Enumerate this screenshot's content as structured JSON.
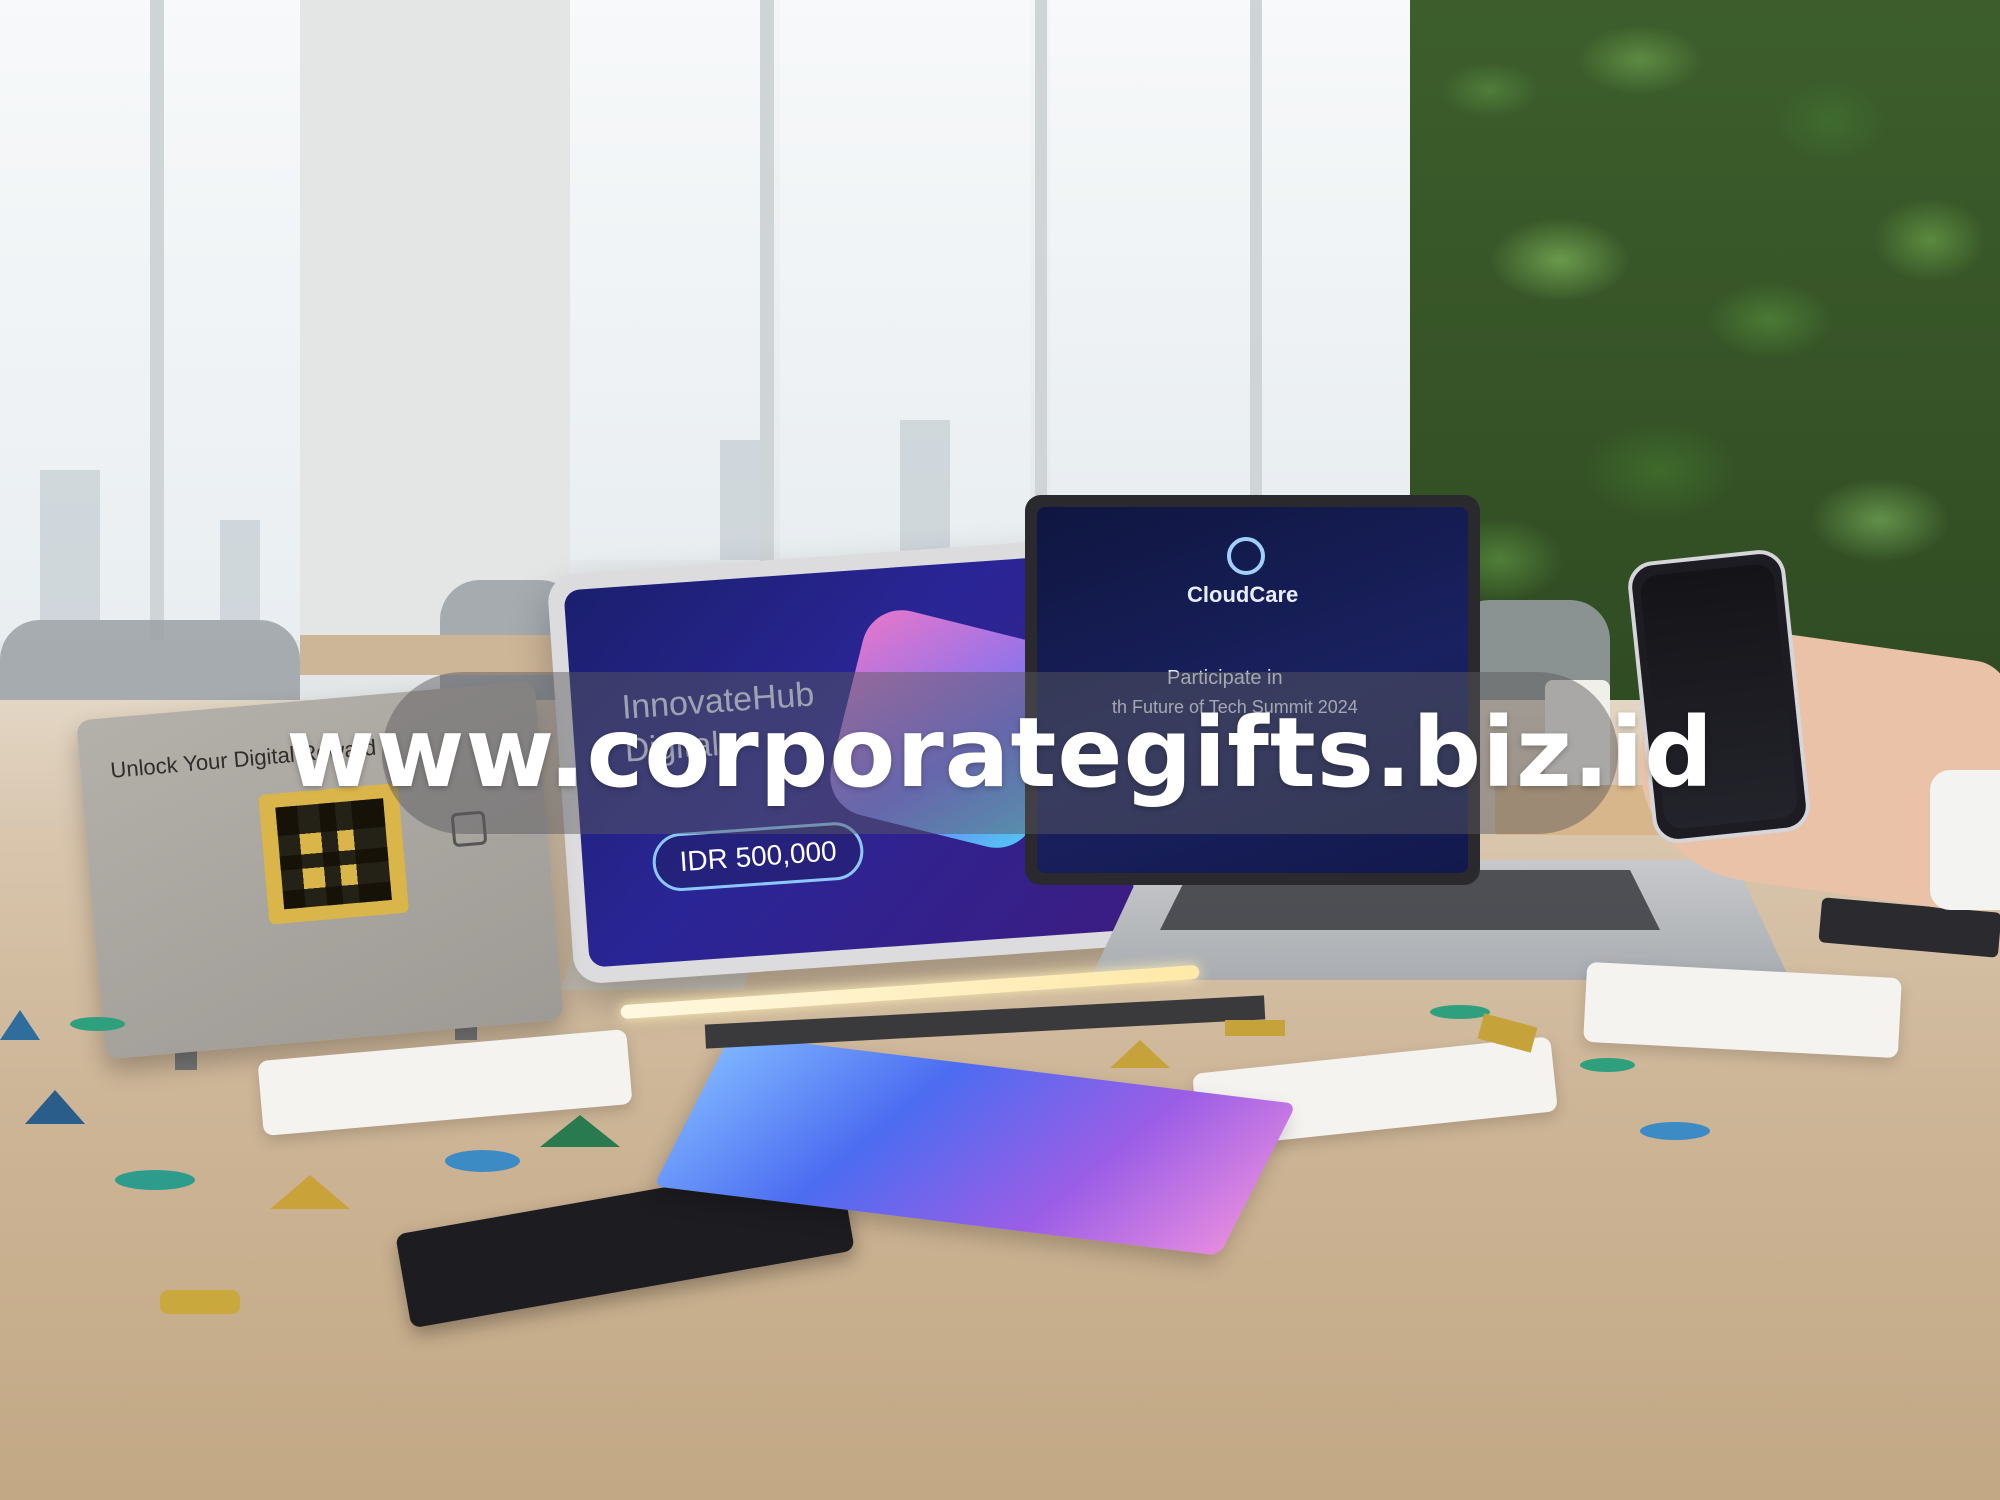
{
  "watermark": {
    "text": "www.corporategifts.biz.id"
  },
  "qr_card": {
    "title": "Unlock Your Digital Reward"
  },
  "tablet": {
    "title": "InnovateHub\nDigital",
    "price": "IDR 500,000"
  },
  "laptop": {
    "brand": "CloudCare",
    "line1": "Participate in",
    "line2": "th Future of Tech Summit 2024"
  },
  "colors": {
    "accent_blue": "#2a2596",
    "watermark_bg": "#5a5a5f",
    "table_wood": "#cdb597"
  }
}
